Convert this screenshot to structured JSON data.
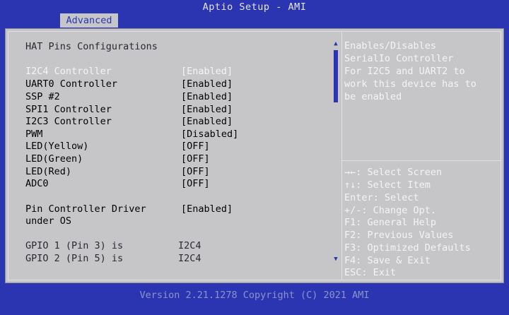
{
  "header": {
    "title": "Aptio Setup - AMI",
    "active_tab": "Advanced"
  },
  "page": {
    "heading": "HAT Pins Configurations",
    "settings": [
      {
        "label": "I2C4 Controller",
        "value": "[Enabled]",
        "selected": true
      },
      {
        "label": "UART0 Controller",
        "value": "[Enabled]"
      },
      {
        "label": "SSP #2",
        "value": "[Enabled]"
      },
      {
        "label": "SPI1 Controller",
        "value": "[Enabled]"
      },
      {
        "label": "I2C3 Controller",
        "value": "[Enabled]"
      },
      {
        "label": "PWM",
        "value": "[Disabled]"
      },
      {
        "label": "LED(Yellow)",
        "value": "[OFF]"
      },
      {
        "label": "LED(Green)",
        "value": "[OFF]"
      },
      {
        "label": "LED(Red)",
        "value": "[OFF]"
      },
      {
        "label": "ADC0",
        "value": "[OFF]"
      }
    ],
    "pin_driver": {
      "label_line1": "Pin Controller Driver",
      "label_line2": "under OS",
      "value": "[Enabled]"
    },
    "gpio": [
      {
        "label": "GPIO  1 (Pin 3) is",
        "value": "I2C4"
      },
      {
        "label": "GPIO  2 (Pin 5) is",
        "value": "I2C4"
      }
    ]
  },
  "help": {
    "lines": [
      "Enables/Disables",
      "SerialIo Controller",
      "For I2C5 and UART2 to",
      "work this device has to",
      "be enabled"
    ]
  },
  "keys": [
    "→←: Select Screen",
    "↑↓: Select Item",
    "Enter: Select",
    "+/-: Change Opt.",
    "F1: General Help",
    "F2: Previous Values",
    "F3: Optimized Defaults",
    "F4: Save & Exit",
    "ESC: Exit"
  ],
  "icons": {
    "scroll_up": "triangle-up-icon",
    "scroll_down": "triangle-down-icon"
  },
  "colors": {
    "background": "#2b35b2",
    "panel": "#c6c6c8",
    "highlight_text": "#f4f4f4",
    "heading_text": "#2a2a30"
  },
  "footer": {
    "text": "Version 2.21.1278 Copyright (C) 2021 AMI"
  }
}
